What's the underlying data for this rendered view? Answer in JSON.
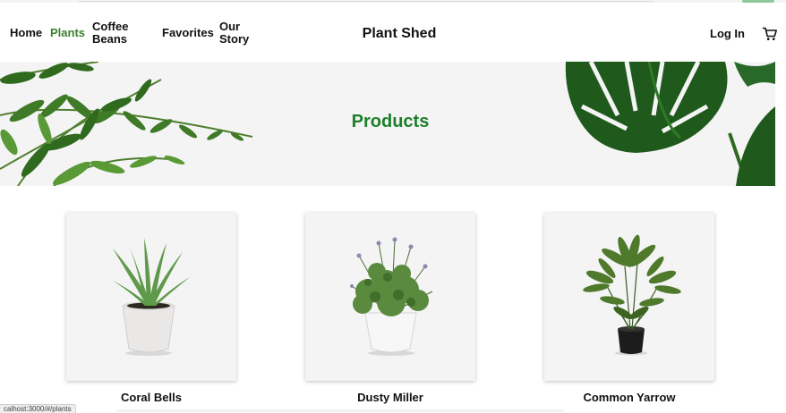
{
  "nav": {
    "items": [
      {
        "label": "Home",
        "active": false
      },
      {
        "label": "Plants",
        "active": true
      },
      {
        "label": "Coffee Beans",
        "active": false
      },
      {
        "label": "Favorites",
        "active": false
      },
      {
        "label": "Our Story",
        "active": false
      }
    ],
    "brand": "Plant Shed",
    "login_label": "Log In",
    "cart_icon": "cart-icon"
  },
  "hero": {
    "title": "Products",
    "left_image": "fern-image",
    "right_image": "monstera-leaf-image"
  },
  "products": [
    {
      "name": "Coral Bells",
      "image": "aloe-in-white-pot"
    },
    {
      "name": "Dusty Miller",
      "image": "lavender-in-white-pot"
    },
    {
      "name": "Common Yarrow",
      "image": "palm-in-black-pot"
    }
  ],
  "status_url": "calhost:3000/#/plants",
  "colors": {
    "active_nav": "#3c7f30",
    "hero_title": "#1e7f2a",
    "hero_bg": "#f4f4f4",
    "card_bg": "#f4f4f4"
  }
}
